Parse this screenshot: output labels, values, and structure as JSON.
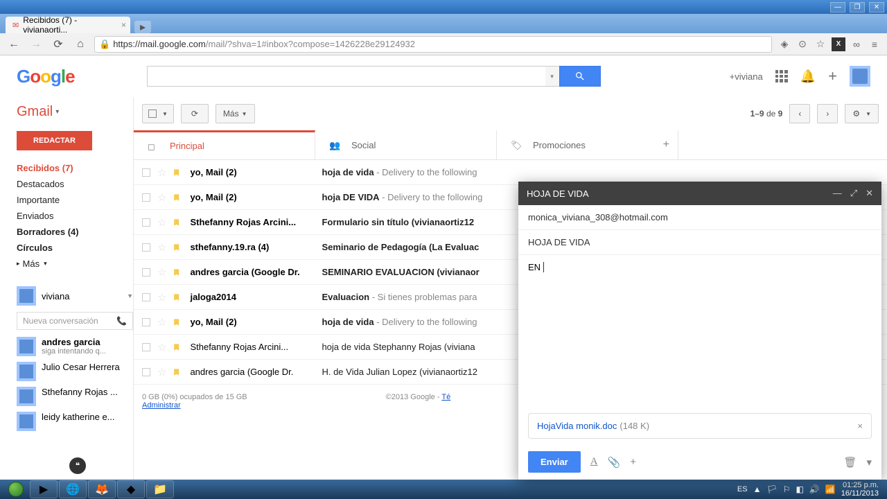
{
  "browser": {
    "tab_title": "Recibidos (7) - vivianaorti...",
    "url_host": "https://mail.google.com",
    "url_path": "/mail/?shva=1#inbox?compose=1426228e29124932"
  },
  "header": {
    "plus_user": "+viviana"
  },
  "gmail": {
    "product": "Gmail",
    "compose": "REDACTAR",
    "nav": {
      "inbox": "Recibidos (7)",
      "starred": "Destacados",
      "important": "Importante",
      "sent": "Enviados",
      "drafts": "Borradores (4)",
      "circles": "Círculos",
      "more": "Más"
    },
    "chat": {
      "me": "viviana",
      "new_conv": "Nueva conversación",
      "contacts": [
        {
          "name": "andres garcia",
          "sub": "siga intentando q..."
        },
        {
          "name": "Julio Cesar Herrera",
          "sub": ""
        },
        {
          "name": "Sthefanny Rojas ...",
          "sub": ""
        },
        {
          "name": "leidy katherine e...",
          "sub": ""
        }
      ]
    }
  },
  "toolbar": {
    "more": "Más",
    "pager": "1–9 de 9"
  },
  "tabs": {
    "primary": "Principal",
    "social": "Social",
    "promotions": "Promociones"
  },
  "emails": [
    {
      "sender": "yo, Mail (2)",
      "bold": true,
      "subject": "hoja de vida",
      "snip": " - Delivery to the following"
    },
    {
      "sender": "yo, Mail (2)",
      "bold": true,
      "subject": "hoja DE VIDA",
      "snip": " - Delivery to the following"
    },
    {
      "sender": "Sthefanny Rojas Arcini...",
      "bold": true,
      "subject": "Formulario sin título (vivianaortiz12",
      "snip": ""
    },
    {
      "sender": "sthefanny.19.ra (4)",
      "bold": true,
      "subject": "Seminario de Pedagogía (La Evaluac",
      "snip": ""
    },
    {
      "sender": "andres garcia (Google Dr.",
      "bold": true,
      "subject": "SEMINARIO EVALUACION (vivianaor",
      "snip": ""
    },
    {
      "sender": "jaloga2014",
      "bold": true,
      "subject": "Evaluacion",
      "snip": " - Si tienes problemas para"
    },
    {
      "sender": "yo, Mail (2)",
      "bold": true,
      "subject": "hoja de vida",
      "snip": " - Delivery to the following"
    },
    {
      "sender": "Sthefanny Rojas Arcini...",
      "bold": false,
      "subject": "hoja de vida Stephanny Rojas (viviana",
      "snip": ""
    },
    {
      "sender": "andres garcia (Google Dr.",
      "bold": false,
      "subject": "H. de Vida Julian Lopez (vivianaortiz12",
      "snip": ""
    }
  ],
  "footer": {
    "storage": "0 GB (0%) ocupados de 15 GB",
    "manage": "Administrar",
    "copyright": "©2013 Google - ",
    "terms": "Té"
  },
  "compose": {
    "title": "HOJA DE VIDA",
    "to": "monica_viviana_308@hotmail.com",
    "subject": "HOJA DE VIDA",
    "body": "EN",
    "attachment_name": "HojaVida monik.doc",
    "attachment_size": "(148 K)",
    "send": "Enviar"
  },
  "taskbar": {
    "lang": "ES",
    "time": "01:25 p.m.",
    "date": "16/11/2013"
  }
}
